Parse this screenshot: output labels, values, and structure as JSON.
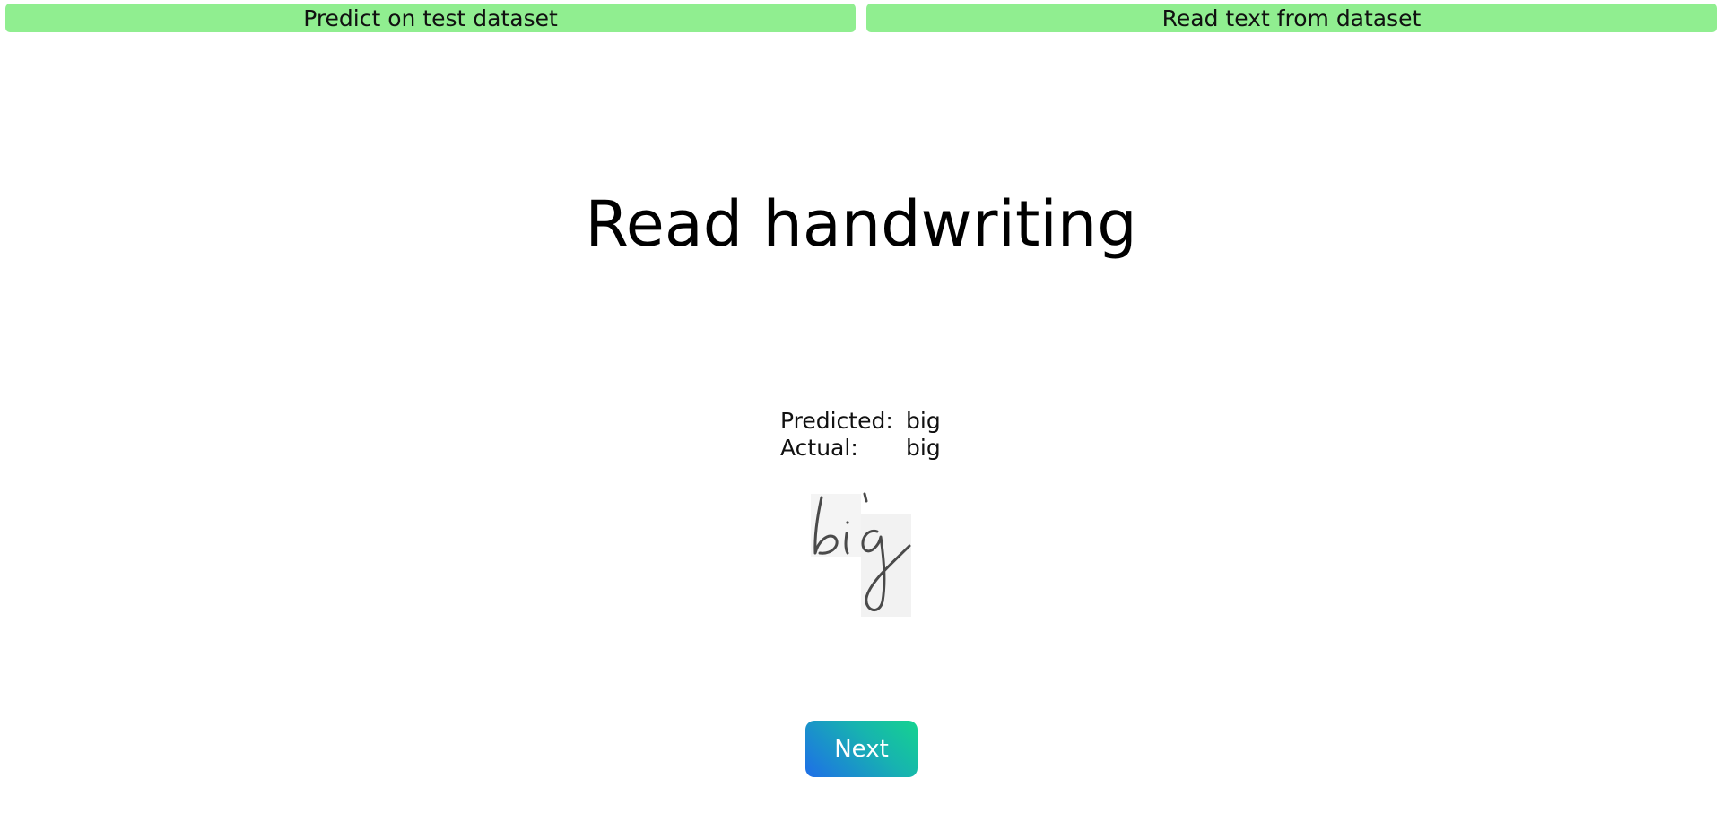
{
  "nav": {
    "predict_label": "Predict on test dataset",
    "read_label": "Read text from dataset"
  },
  "page": {
    "title": "Read handwriting"
  },
  "result": {
    "predicted_label": "Predicted:",
    "predicted_value": "big",
    "actual_label": "Actual:",
    "actual_value": "big"
  },
  "sample": {
    "handwritten_text": "big"
  },
  "actions": {
    "next_label": "Next"
  },
  "colors": {
    "nav_button_bg": "#90ee90",
    "next_gradient_start": "#1e6ee8",
    "next_gradient_end": "#15d38f"
  }
}
